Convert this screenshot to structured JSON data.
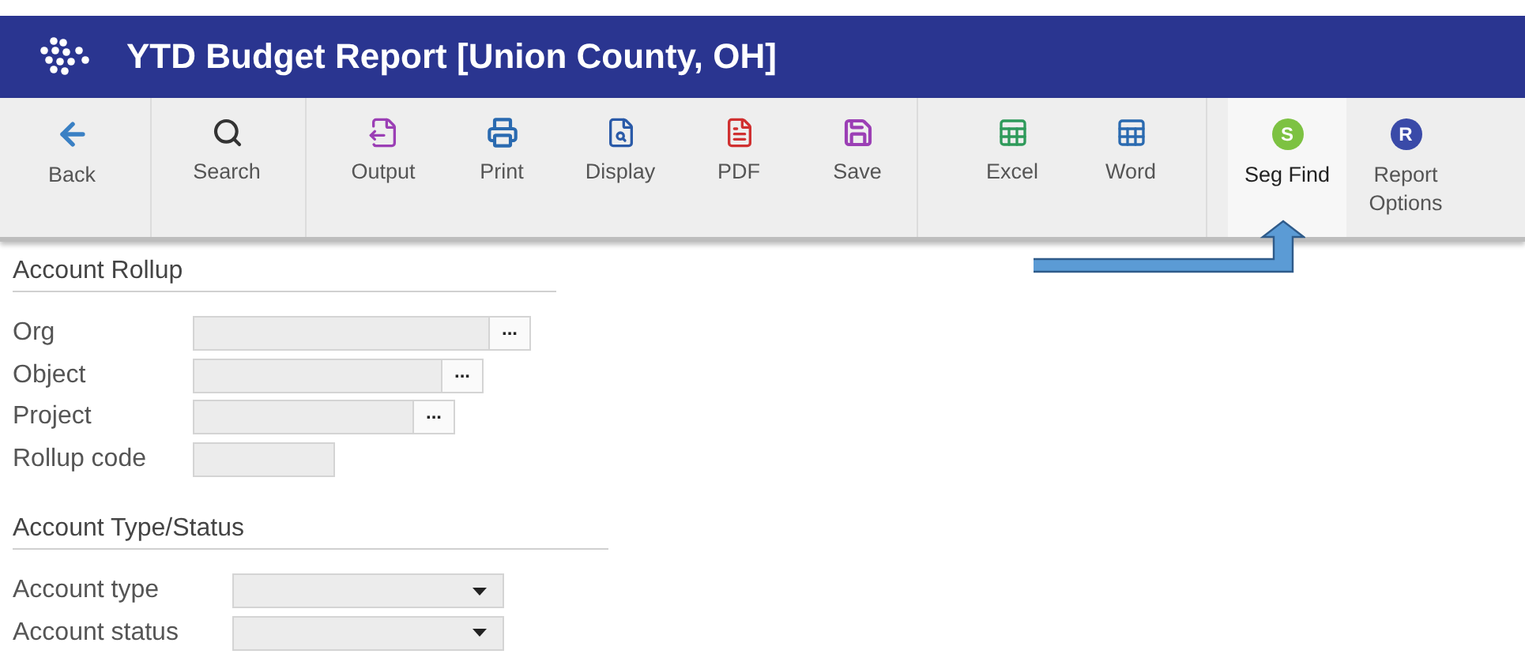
{
  "window": {
    "title": "YTD Budget Report [Union County, OH]"
  },
  "toolbar": {
    "groups": [
      {
        "buttons": [
          {
            "label": "Back",
            "kind": "icon",
            "selected": false
          }
        ]
      },
      {
        "buttons": [
          {
            "label": "Search",
            "kind": "icon",
            "selected": false
          }
        ]
      },
      {
        "buttons": [
          {
            "label": "Output",
            "kind": "icon",
            "selected": false
          },
          {
            "label": "Print",
            "kind": "icon",
            "selected": false
          },
          {
            "label": "Display",
            "kind": "icon",
            "selected": false
          },
          {
            "label": "PDF",
            "kind": "icon",
            "selected": false
          },
          {
            "label": "Save",
            "kind": "icon",
            "selected": false
          }
        ]
      },
      {
        "buttons": [
          {
            "label": "Excel",
            "kind": "icon",
            "selected": false
          },
          {
            "label": "Word",
            "kind": "icon",
            "selected": false
          }
        ]
      },
      {
        "buttons": [
          {
            "label": "Seg Find",
            "kind": "badge",
            "badge": "S",
            "color": "#7dc242",
            "selected": true
          },
          {
            "label": "Report Options",
            "kind": "badge",
            "badge": "R",
            "color": "#3a4aa8",
            "selected": false
          }
        ]
      }
    ]
  },
  "sections": [
    {
      "title": "Account Rollup",
      "fields": [
        {
          "label": "Org",
          "kind": "lookup",
          "lookup_button": "..."
        },
        {
          "label": "Object",
          "kind": "lookup",
          "lookup_button": "..."
        },
        {
          "label": "Project",
          "kind": "lookup",
          "lookup_button": "..."
        },
        {
          "label": "Rollup code",
          "kind": "text"
        }
      ]
    },
    {
      "title": "Account Type/Status",
      "fields": [
        {
          "label": "Account type",
          "kind": "select"
        },
        {
          "label": "Account status",
          "kind": "select"
        }
      ]
    }
  ]
}
